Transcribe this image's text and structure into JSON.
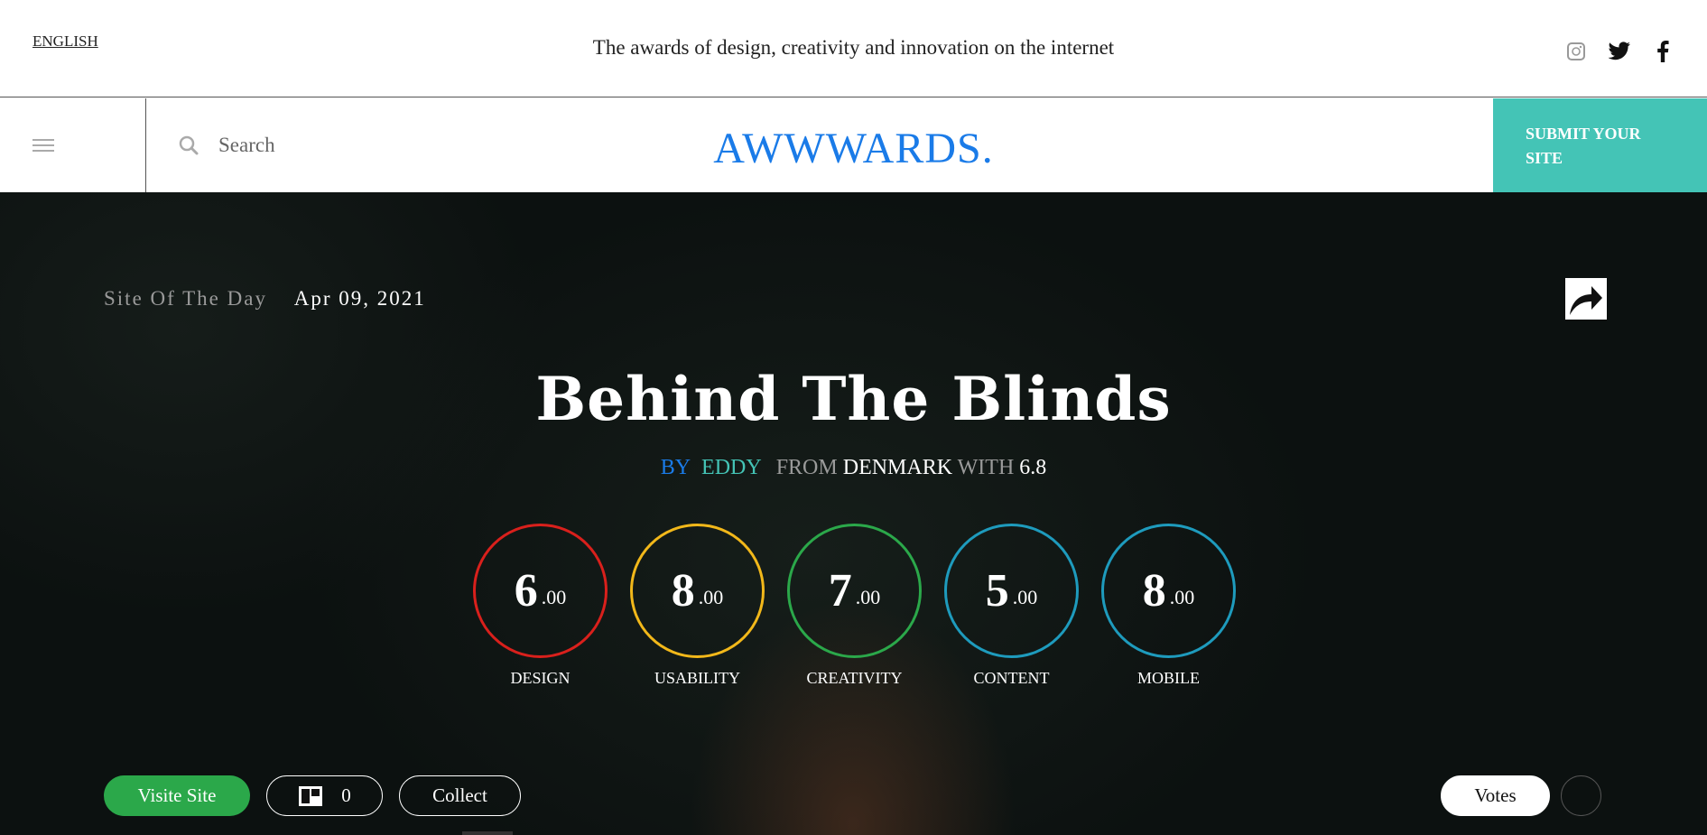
{
  "topbar": {
    "language": "ENGLISH",
    "tagline": "The awards of design, creativity and innovation on the internet",
    "social": [
      "instagram-icon",
      "twitter-icon",
      "facebook-icon"
    ]
  },
  "navbar": {
    "search_placeholder": "Search",
    "logo": "AWWWARDS.",
    "submit_label": "SUBMIT YOUR SITE"
  },
  "hero": {
    "badge_label": "Site Of The Day",
    "date": "Apr 09, 2021",
    "site_title": "Behind The Blinds",
    "by_label": "BY",
    "author": "EDDY",
    "from_label": "FROM",
    "country": "DENMARK",
    "with_label": "WITH",
    "overall_score": "6.8",
    "scores": [
      {
        "value": "6",
        "decimal": ".00",
        "label": "DESIGN",
        "color": "#d9201c"
      },
      {
        "value": "8",
        "decimal": ".00",
        "label": "USABILITY",
        "color": "#f2b81a"
      },
      {
        "value": "7",
        "decimal": ".00",
        "label": "CREATIVITY",
        "color": "#2ba84a"
      },
      {
        "value": "5",
        "decimal": ".00",
        "label": "CONTENT",
        "color": "#1e9bbd"
      },
      {
        "value": "8",
        "decimal": ".00",
        "label": "MOBILE",
        "color": "#1e9bbd"
      }
    ],
    "visit_label": "Visite Site",
    "like_count": "0",
    "collect_label": "Collect",
    "votes_label": "Votes"
  },
  "colors": {
    "brand_blue": "#1a7be8",
    "teal": "#44c4b6",
    "visit_green": "#2ba84a"
  }
}
